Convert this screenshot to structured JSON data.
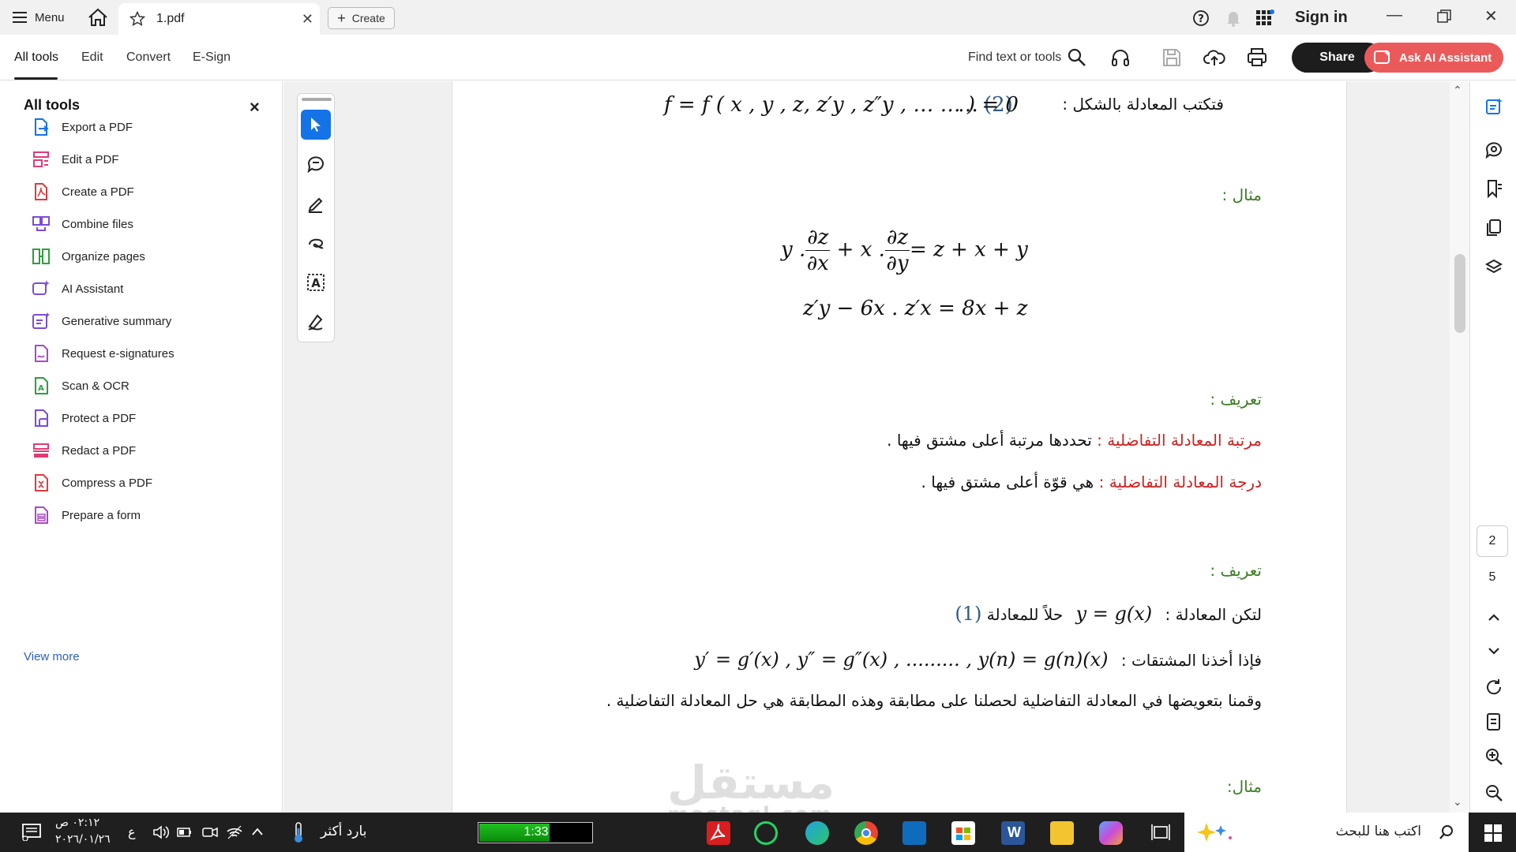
{
  "titlebar": {
    "menu_label": "Menu",
    "tab_title": "1.pdf",
    "create_label": "Create",
    "sign_in_label": "Sign in"
  },
  "toolbar": {
    "tabs": [
      "All tools",
      "Edit",
      "Convert",
      "E-Sign"
    ],
    "find_label": "Find text or tools",
    "share_label": "Share",
    "ai_label": "Ask AI Assistant"
  },
  "tools_panel": {
    "title": "All tools",
    "items": [
      {
        "label": "Export a PDF",
        "icon": "export-pdf-icon",
        "color": "#1473e6"
      },
      {
        "label": "Edit a PDF",
        "icon": "edit-pdf-icon",
        "color": "#e03a7a"
      },
      {
        "label": "Create a PDF",
        "icon": "create-pdf-icon",
        "color": "#e0393e"
      },
      {
        "label": "Combine files",
        "icon": "combine-files-icon",
        "color": "#7b4cd8"
      },
      {
        "label": "Organize pages",
        "icon": "organize-pages-icon",
        "color": "#2e9e3e"
      },
      {
        "label": "AI Assistant",
        "icon": "ai-assistant-icon",
        "color": "#7b4cd8"
      },
      {
        "label": "Generative summary",
        "icon": "generative-summary-icon",
        "color": "#7b4cd8"
      },
      {
        "label": "Request e-signatures",
        "icon": "request-esign-icon",
        "color": "#a64bc6"
      },
      {
        "label": "Scan & OCR",
        "icon": "scan-ocr-icon",
        "color": "#2e9e3e"
      },
      {
        "label": "Protect a PDF",
        "icon": "protect-pdf-icon",
        "color": "#7b4cd8"
      },
      {
        "label": "Redact a PDF",
        "icon": "redact-pdf-icon",
        "color": "#e03a7a"
      },
      {
        "label": "Compress a PDF",
        "icon": "compress-pdf-icon",
        "color": "#e0393e"
      },
      {
        "label": "Prepare a form",
        "icon": "prepare-form-icon",
        "color": "#a64bc6"
      }
    ],
    "view_more": "View more"
  },
  "document": {
    "line1_ar": "فتكتب المعادلة بالشكل :",
    "line1_eq": "f = f ( x , y , z, z′y , z″y , … … ) = 0",
    "line1_dots": "…",
    "line1_ref": "(2)",
    "example1": "مثال :",
    "eq_a_rhs": "= z + x + y",
    "eq_b": "z′y −  6x . z′x = 8x + z",
    "def1": "تعريف :",
    "order_label": "مرتبة المعادلة التفاضلية :",
    "order_text": "تحددها مرتبة أعلى مشتق فيها .",
    "degree_label": "درجة المعادلة التفاضلية :",
    "degree_text": "هي قوّة أعلى مشتق فيها .",
    "def2": "تعريف :",
    "sol_ar": "لتكن المعادلة :",
    "sol_eq": "y = g(x)",
    "sol_ar2": "حلاً للمعادلة",
    "sol_ref": "(1)",
    "deriv_ar": "فإذا أخذنا المشتقات :",
    "deriv_eq": "y′ = g′(x) ,  y″ = g″(x) , ......... ,  y(n) = g(n)(x)",
    "subst_ar": "وقمنا بتعويضها في المعادلة التفاضلية لحصلنا على مطابقة وهذه المطابقة هي حل المعادلة التفاضلية .",
    "example2": "مثال:",
    "watermark": "مستقل",
    "watermark_sub": "mostaql.com"
  },
  "right_rail": {
    "current_page": "2",
    "total_pages": "5"
  },
  "taskbar": {
    "time": "٠٢:١٢ ص",
    "date": "٢٠٢٦/٠١/٢٦",
    "lang": "ع",
    "weather": "بارد أكثر",
    "timer": "1:33",
    "timer_progress": 0.62,
    "search_placeholder": "اكتب هنا للبحث"
  },
  "colors": {
    "accent": "#1473e6",
    "ai_button": "#eb5a5a",
    "arabic_heading": "#3b7d23",
    "arabic_term": "#d11f1f"
  }
}
